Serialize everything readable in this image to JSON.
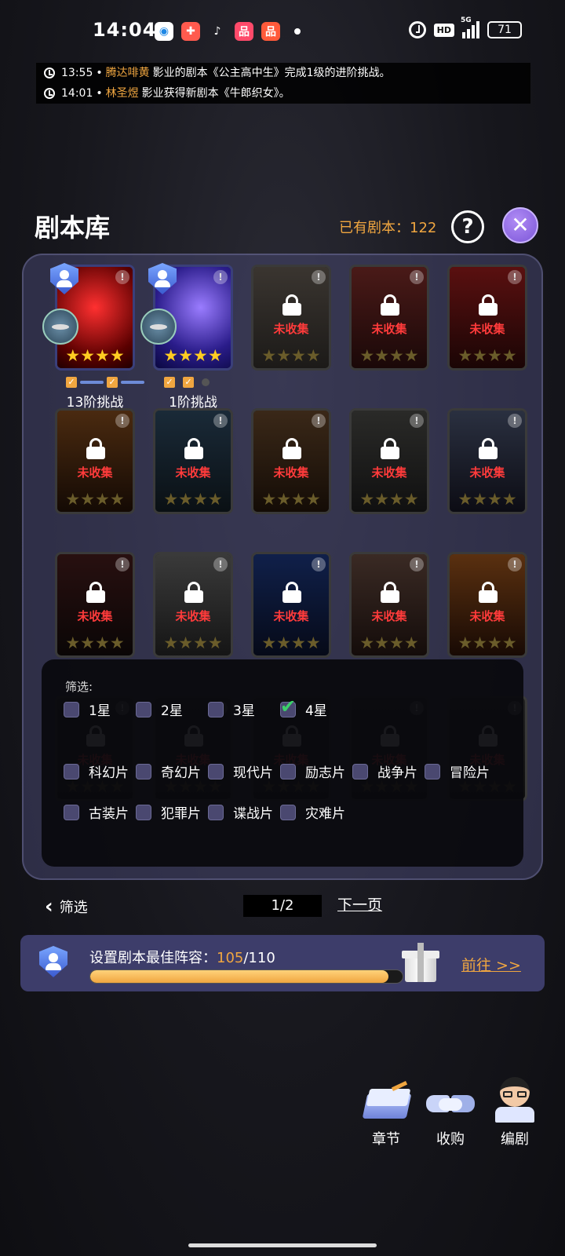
{
  "status_bar": {
    "time": "14:04",
    "hd": "HD",
    "network": "5G",
    "battery": "71",
    "apps": [
      {
        "name": "browser-app-icon",
        "glyph": "◉",
        "bg": "#ffffff",
        "fg": "#1e88e5"
      },
      {
        "name": "game-app-icon",
        "glyph": "✚",
        "bg": "#ff5a4e",
        "fg": "#ffffff"
      },
      {
        "name": "tiktok-app-icon",
        "glyph": "♪",
        "bg": "transparent",
        "fg": "#ffffff"
      },
      {
        "name": "shop-app-icon-1",
        "glyph": "品",
        "bg": "#ff4a6a",
        "fg": "#ffffff"
      },
      {
        "name": "shop-app-icon-2",
        "glyph": "品",
        "bg": "#ff5a3a",
        "fg": "#ffffff"
      }
    ]
  },
  "news": [
    {
      "time": "13:55",
      "sep": "•",
      "name": "腾达啡黄",
      "text": "影业的剧本《公主高中生》完成1级的进阶挑战。"
    },
    {
      "time": "14:01",
      "sep": "•",
      "name": "林圣煜",
      "text": "影业获得新剧本《牛郎织女》。"
    }
  ],
  "header": {
    "title": "剧本库",
    "owned_label": "已有剧本：",
    "owned_count": "122",
    "help": "?",
    "close": "✕"
  },
  "cards": {
    "status_text": "未收集",
    "info": "!",
    "stars": "★★★★",
    "owned_challenges": [
      "13阶挑战",
      "1阶挑战"
    ]
  },
  "filter": {
    "title": "筛选:",
    "stars": [
      {
        "label": "1星",
        "checked": false
      },
      {
        "label": "2星",
        "checked": false
      },
      {
        "label": "3星",
        "checked": false
      },
      {
        "label": "4星",
        "checked": true
      }
    ],
    "genres_row1": [
      "科幻片",
      "奇幻片",
      "现代片",
      "励志片",
      "战争片",
      "冒险片"
    ],
    "genres_row2": [
      "古装片",
      "犯罪片",
      "谍战片",
      "灾难片"
    ]
  },
  "pagination": {
    "back_label": "筛选",
    "page": "1/2",
    "next_label": "下一页"
  },
  "lineup": {
    "label": "设置剧本最佳阵容：",
    "current": "105",
    "total": "/110",
    "progress": 0.955,
    "goto_label": "前往  >>"
  },
  "bottom_nav": [
    {
      "label": "章节",
      "icon": "book-icon"
    },
    {
      "label": "收购",
      "icon": "handshake-icon"
    },
    {
      "label": "编剧",
      "icon": "writer-avatar-icon"
    }
  ]
}
